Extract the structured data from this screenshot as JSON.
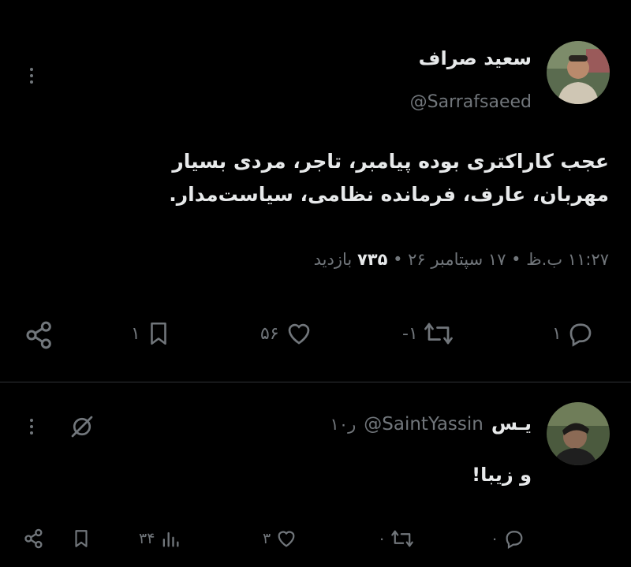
{
  "main_tweet": {
    "author_name": "سعید صراف",
    "handle": "@Sarrafsaeed",
    "text_line1": "عجب کاراکتری بوده پیامبر، تاجر، مردی بسیار",
    "text_line2": "مهربان، عارف، فرمانده نظامی، سیاست‌مدار.",
    "time": "۱۱:۲۷ ب.ظ",
    "date": "۱۷ سپتامبر ۲۶",
    "views_count": "۷۳۵",
    "views_label": "بازدید",
    "separator": "•",
    "replies": "۱",
    "retweets": "-۱",
    "likes": "۵۶",
    "bookmarks": "۱",
    "icons": [
      "more-icon",
      "avatar",
      "reply-icon",
      "retweet-icon",
      "like-icon",
      "bookmark-icon",
      "share-icon"
    ]
  },
  "reply_tweet": {
    "author_name": "یـس",
    "handle": "@SaintYassin",
    "age": "۱۰ر",
    "text": "و زیبا!",
    "replies": "۰",
    "retweets": "۰",
    "likes": "۳",
    "views": "۳۴",
    "icons": [
      "more-icon",
      "grok-icon",
      "reply-icon",
      "retweet-icon",
      "like-icon",
      "views-icon",
      "bookmark-icon",
      "share-icon"
    ]
  },
  "colors": {
    "background": "#000000",
    "text": "#e7e9ea",
    "muted": "#71767b",
    "divider": "#2f3336"
  }
}
